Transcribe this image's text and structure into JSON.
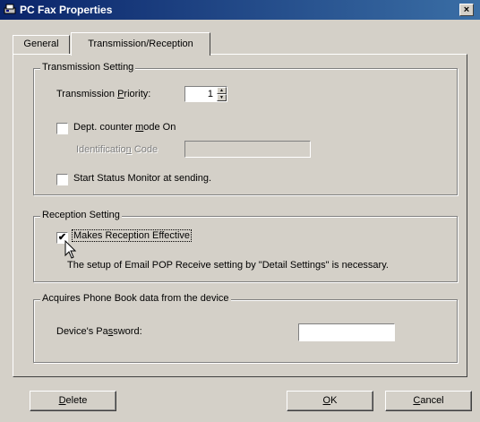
{
  "window": {
    "title": "PC Fax Properties",
    "close_glyph": "×"
  },
  "tabs": [
    {
      "label": "General",
      "active": false
    },
    {
      "label": "Transmission/Reception",
      "active": true
    }
  ],
  "transmission": {
    "legend": "Transmission Setting",
    "priority_label": "Transmission Priority:",
    "priority_value": "1",
    "dept_counter_label": "Dept. counter mode On",
    "dept_counter_checked": false,
    "id_code_label": "Identification Code",
    "id_code_value": "",
    "status_monitor_label": "Start Status Monitor at sending.",
    "status_monitor_checked": false
  },
  "reception": {
    "legend": "Reception Setting",
    "effective_label": "Makes Reception Effective",
    "effective_checked": true,
    "check_glyph": "✔",
    "note": "The setup of Email POP Receive setting by \"Detail Settings\" is necessary."
  },
  "phonebook": {
    "legend": "Acquires Phone Book data from the device",
    "password_label": "Device's Password:",
    "password_value": ""
  },
  "buttons": {
    "delete": "Delete",
    "ok": "OK",
    "cancel": "Cancel"
  },
  "icons": {
    "window_icon": "fax-icon",
    "cursor": "mouse-pointer-icon"
  }
}
